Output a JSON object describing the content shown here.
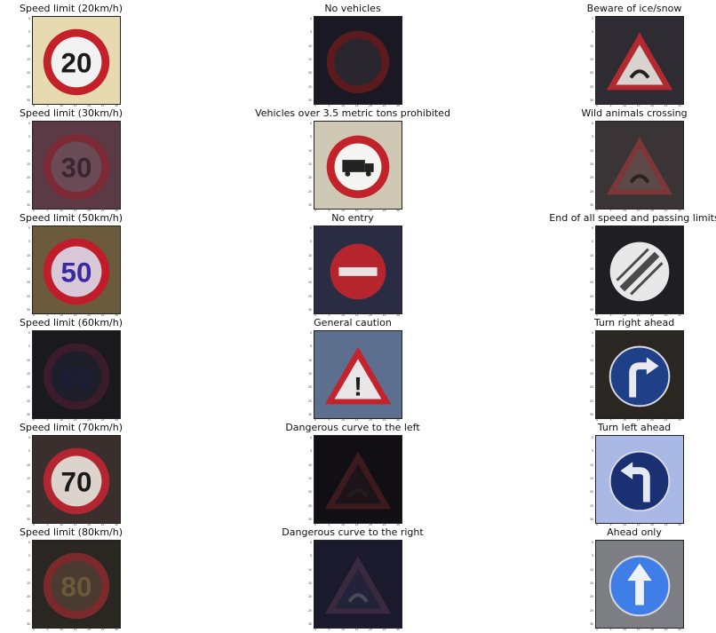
{
  "figure": {
    "panels": [
      {
        "title": "Speed limit (20km/h)",
        "icon": "speed-limit-sign",
        "text": "20",
        "bg": "#e7d9b0",
        "sign_bg": "#f2f2f2",
        "ring": "#c3202a",
        "fg": "#1a1a1a"
      },
      {
        "title": "No vehicles",
        "icon": "no-vehicles-sign",
        "text": "",
        "bg": "#1a1822",
        "sign_bg": "#2a2630",
        "ring": "#5a1a1e",
        "fg": "#333"
      },
      {
        "title": "Beware of ice/snow",
        "icon": "ice-snow-warning-sign",
        "text": "",
        "bg": "#2e2b33",
        "sign_bg": "#d9d3d0",
        "ring": "#b02a30",
        "fg": "#222"
      },
      {
        "title": "Speed limit (30km/h)",
        "icon": "speed-limit-sign",
        "text": "30",
        "bg": "#5b3a46",
        "sign_bg": "#6a4a55",
        "ring": "#7c2a35",
        "fg": "#3a2630"
      },
      {
        "title": "Vehicles over 3.5 metric tons prohibited",
        "icon": "no-trucks-sign",
        "text": "",
        "bg": "#cfc8b4",
        "sign_bg": "#f4f4f2",
        "ring": "#c2232b",
        "fg": "#222"
      },
      {
        "title": "Wild animals crossing",
        "icon": "wild-animals-warning-sign",
        "text": "",
        "bg": "#3a3436",
        "sign_bg": "#5c4a48",
        "ring": "#7a3838",
        "fg": "#2a2222"
      },
      {
        "title": "Speed limit (50km/h)",
        "icon": "speed-limit-sign",
        "text": "50",
        "bg": "#6b5a3c",
        "sign_bg": "#d8c8d8",
        "ring": "#c01c2a",
        "fg": "#3a2aa0"
      },
      {
        "title": "No entry",
        "icon": "no-entry-sign",
        "text": "",
        "bg": "#2a2c44",
        "sign_bg": "#b5252e",
        "ring": "#b5252e",
        "fg": "#e8e2e2"
      },
      {
        "title": "End of all speed and passing limits",
        "icon": "end-of-limits-sign",
        "text": "",
        "bg": "#1f1f22",
        "sign_bg": "#e8e8e8",
        "ring": "#cfcfcf",
        "fg": "#4a4a4a"
      },
      {
        "title": "Speed limit (60km/h)",
        "icon": "speed-limit-sign",
        "text": "60",
        "bg": "#1a1a1e",
        "sign_bg": "#1e1e2a",
        "ring": "#3a1c2a",
        "fg": "#1a1e3a"
      },
      {
        "title": "General caution",
        "icon": "general-caution-sign",
        "text": "!",
        "bg": "#5d6f8e",
        "sign_bg": "#e8e6e6",
        "ring": "#c4222c",
        "fg": "#1a1a1a"
      },
      {
        "title": "Turn right ahead",
        "icon": "turn-right-sign",
        "text": "",
        "bg": "#2a2622",
        "sign_bg": "#1f3f86",
        "ring": "#1f3f86",
        "fg": "#e9e9ef"
      },
      {
        "title": "Speed limit (70km/h)",
        "icon": "speed-limit-sign",
        "text": "70",
        "bg": "#3a2f2c",
        "sign_bg": "#dcd4cc",
        "ring": "#b32530",
        "fg": "#1a1a1a"
      },
      {
        "title": "Dangerous curve to the left",
        "icon": "curve-left-warning-sign",
        "text": "",
        "bg": "#120f14",
        "sign_bg": "#1c1418",
        "ring": "#3c1a1e",
        "fg": "#241c1c"
      },
      {
        "title": "Turn left ahead",
        "icon": "turn-left-sign",
        "text": "",
        "bg": "#a9b8e4",
        "sign_bg": "#1b2f73",
        "ring": "#1b2f73",
        "fg": "#e4e8f2"
      },
      {
        "title": "Speed limit (80km/h)",
        "icon": "speed-limit-sign",
        "text": "80",
        "bg": "#2a2622",
        "sign_bg": "#4a3a30",
        "ring": "#7a2a2a",
        "fg": "#6a5a3a"
      },
      {
        "title": "Dangerous curve to the right",
        "icon": "curve-right-warning-sign",
        "text": "",
        "bg": "#1a1a2c",
        "sign_bg": "#22223a",
        "ring": "#3a2a40",
        "fg": "#4a4a5a"
      },
      {
        "title": "Ahead only",
        "icon": "ahead-only-sign",
        "text": "",
        "bg": "#7d7e83",
        "sign_bg": "#3f7ee6",
        "ring": "#3f7ee6",
        "fg": "#eef2fb"
      }
    ],
    "ytick_labels": [
      "0",
      "5",
      "10",
      "15",
      "20",
      "25",
      "30"
    ],
    "xtick_labels": [
      "0",
      "5",
      "10",
      "15",
      "20",
      "25",
      "30"
    ]
  }
}
